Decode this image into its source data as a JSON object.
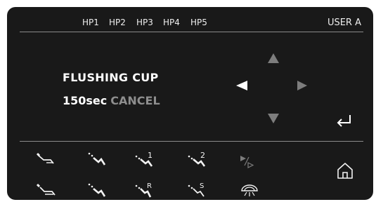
{
  "header": {
    "handpiece_tabs": [
      "HP1",
      "HP2",
      "HP3",
      "HP4",
      "HP5"
    ],
    "user_label": "USER A"
  },
  "status": {
    "title": "FLUSHING CUP",
    "value": "150sec",
    "cancel_label": "CANCEL"
  },
  "navigation": {
    "up": "arrow-up-icon",
    "down": "arrow-down-icon",
    "left": "arrow-left-icon",
    "right": "arrow-right-icon",
    "enter": "enter-return-icon",
    "home": "home-icon"
  },
  "function_icons": {
    "row1": [
      {
        "name": "rinse-handpiece-icon"
      },
      {
        "name": "spray-handpiece-icon"
      },
      {
        "name": "handpiece-1-icon",
        "label": "1"
      },
      {
        "name": "handpiece-2-icon",
        "label": "2"
      },
      {
        "name": "play-step-icon"
      }
    ],
    "row2": [
      {
        "name": "water-handpiece-icon"
      },
      {
        "name": "air-handpiece-icon"
      },
      {
        "name": "handpiece-r-icon",
        "label": "R"
      },
      {
        "name": "handpiece-s-icon",
        "label": "S"
      },
      {
        "name": "light-icon"
      }
    ]
  },
  "colors": {
    "panel_bg": "#191919",
    "active_text": "#ffffff",
    "inactive": "#7d7d7d"
  }
}
